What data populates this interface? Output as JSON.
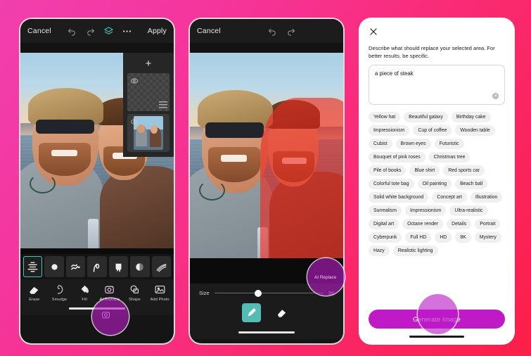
{
  "background": {
    "gradient_from": "#f13fae",
    "gradient_to": "#fb1f48"
  },
  "accent": {
    "teal": "#45c5c0",
    "purple": "#c019c6",
    "mask_red": "#ed281e"
  },
  "phone1": {
    "topbar": {
      "cancel": "Cancel",
      "undo_icon": "undo-icon",
      "redo_icon": "redo-icon",
      "layers_icon": "layers-icon",
      "more_icon": "more-options-icon",
      "apply": "Apply"
    },
    "layers": {
      "add_label": "+",
      "layer_selected_name": "transparent-layer",
      "layer_photo_name": "photo-layer"
    },
    "brush_presets": [
      "lines-brush",
      "dot-brush",
      "squiggle-brush",
      "curve-brush",
      "drip-brush",
      "halftone-brush",
      "fan-brush"
    ],
    "selected_brush_index": 0,
    "tools": [
      {
        "label": "Erase",
        "icon": "eraser-icon"
      },
      {
        "label": "Smudge",
        "icon": "smudge-icon"
      },
      {
        "label": "Fill",
        "icon": "fill-icon"
      },
      {
        "label": "AI Replace",
        "icon": "ai-replace-icon"
      },
      {
        "label": "Shape",
        "icon": "shape-icon"
      },
      {
        "label": "Add Photo",
        "icon": "add-photo-icon"
      }
    ],
    "active_tool": "AI Replace"
  },
  "phone2": {
    "topbar": {
      "cancel": "Cancel",
      "undo_icon": "undo-icon",
      "redo_icon": "redo-icon"
    },
    "ai_replace_button": "AI Replace",
    "size": {
      "label": "Size",
      "value": "36"
    },
    "brush_tools": [
      {
        "name": "paintbrush-icon",
        "selected": true
      },
      {
        "name": "eraser-icon",
        "selected": false
      }
    ]
  },
  "phone3": {
    "close_icon": "close-icon",
    "hint": "Describe what should replace your selected area. For better results, be specific.",
    "prompt_value": "a piece of steak",
    "clear_icon": "clear-text-icon",
    "suggestions": [
      "Yellow hat",
      "Beautiful galaxy",
      "Birthday cake",
      "Impressionism",
      "Cup of coffee",
      "Wooden table",
      "Cubist",
      "Brown eyes",
      "Futuristic",
      "Bouquet of pink roses",
      "Christmas tree",
      "Pile of books",
      "Blue shirt",
      "Red sports car",
      "Colorful tote bag",
      "Oil painting",
      "Beach ball",
      "Solid white background",
      "Concept art",
      "Illustration",
      "Surrealism",
      "Impressionism",
      "Ultra-realistic",
      "Digital art",
      "Octane render",
      "Details",
      "Portrait",
      "Cyberpunk",
      "Full HD",
      "HD",
      "8K",
      "Mystery",
      "Hazy",
      "Realistic lighting"
    ],
    "generate_label": "Generate Image"
  }
}
